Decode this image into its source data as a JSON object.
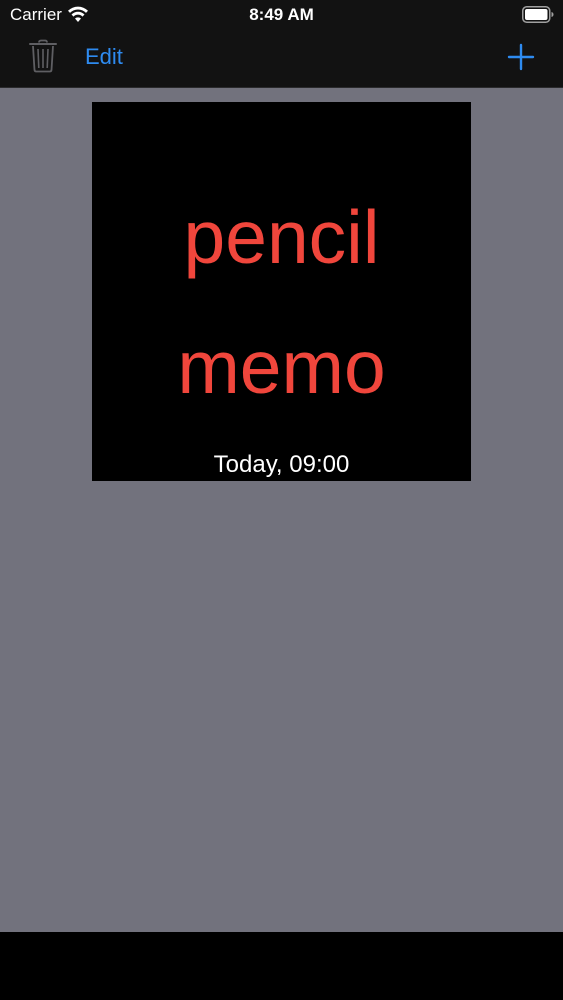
{
  "status_bar": {
    "carrier": "Carrier",
    "time": "8:49 AM",
    "wifi_icon": "wifi-icon",
    "battery_icon": "battery-icon"
  },
  "nav_bar": {
    "trash_icon": "trash-icon",
    "edit_label": "Edit",
    "add_icon": "plus-icon",
    "accent_color": "#2E8BF0"
  },
  "memos": [
    {
      "text": "pencil\nmemo",
      "date": "Today, 09:00",
      "text_color": "#F0463C"
    }
  ],
  "colors": {
    "content_background": "#72727D",
    "bar_background": "#121212"
  }
}
